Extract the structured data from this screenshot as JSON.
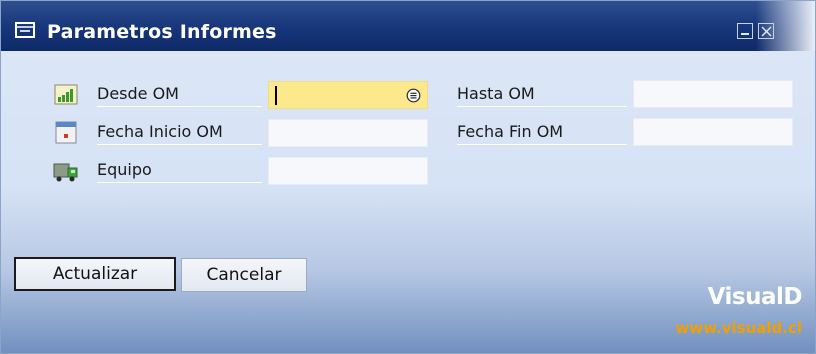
{
  "window": {
    "title": "Parametros Informes",
    "icon": "form-icon",
    "controls": {
      "minimize": "minimize-icon",
      "close": "close-icon"
    }
  },
  "fields": {
    "desde_om": {
      "label": "Desde OM",
      "value": "",
      "icon": "chart-icon",
      "lookup_icon": "lookup-icon"
    },
    "hasta_om": {
      "label": "Hasta OM",
      "value": ""
    },
    "fecha_inicio_om": {
      "label": "Fecha Inicio OM",
      "value": "",
      "icon": "calendar-icon"
    },
    "fecha_fin_om": {
      "label": "Fecha Fin OM",
      "value": ""
    },
    "equipo": {
      "label": "Equipo",
      "value": "",
      "icon": "truck-icon"
    }
  },
  "buttons": {
    "update": "Actualizar",
    "cancel": "Cancelar"
  },
  "branding": {
    "name": "VisualD",
    "url": "www.visuald.cl"
  },
  "colors": {
    "titlebar": "#16357a",
    "active_field": "#fbe98b",
    "brand_url": "#f0a000"
  }
}
